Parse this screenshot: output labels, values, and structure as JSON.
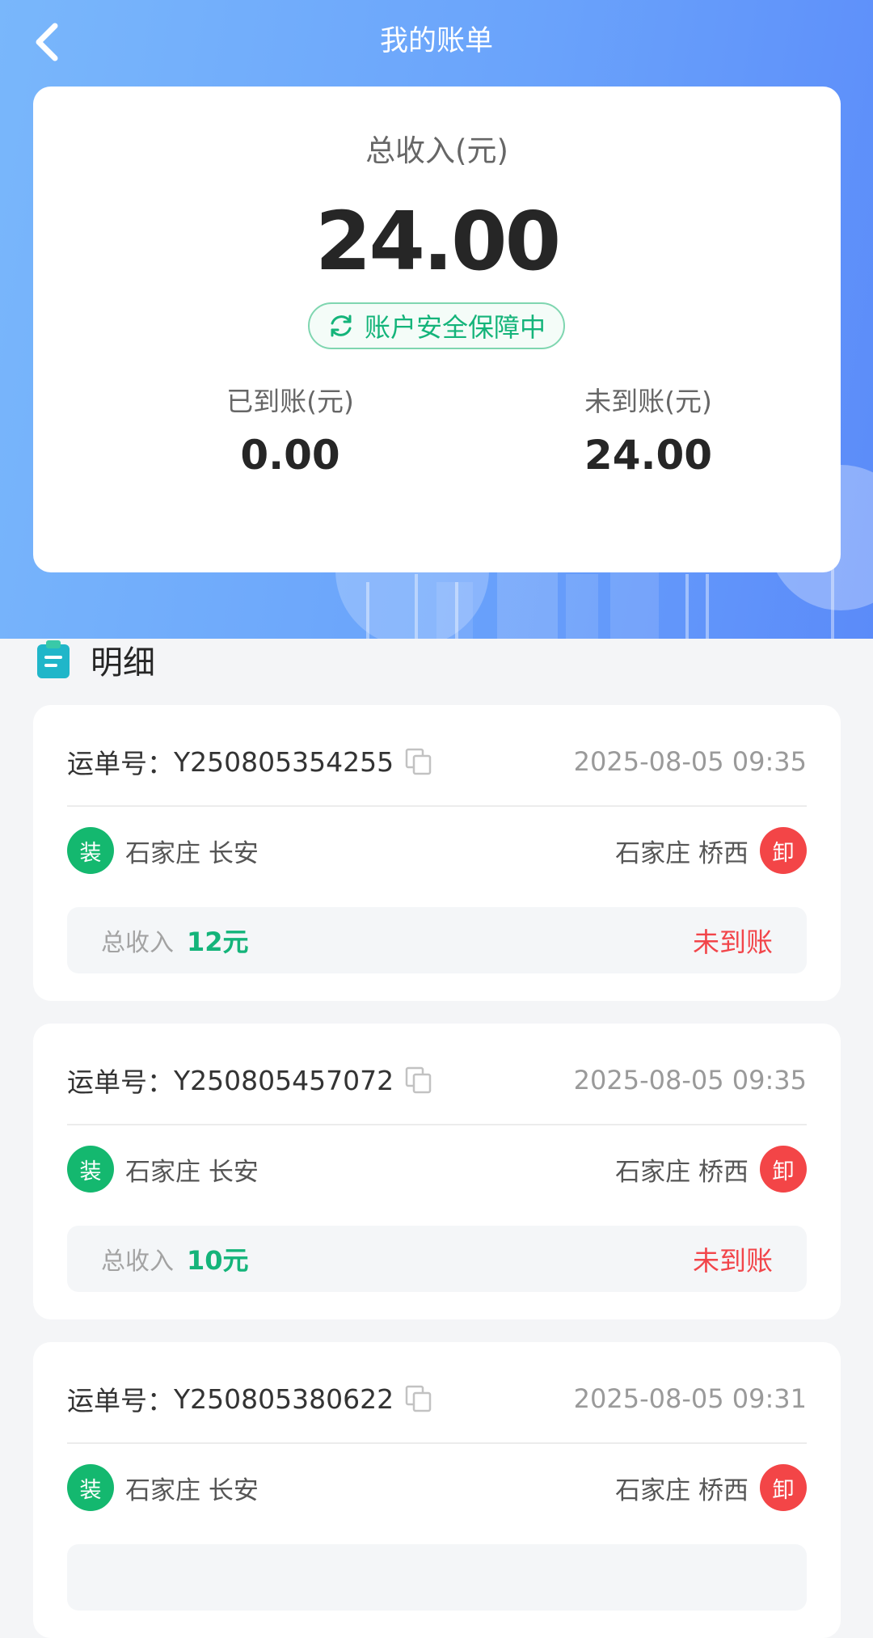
{
  "header": {
    "title": "我的账单",
    "back_icon": "chevron-left-icon"
  },
  "summary": {
    "total_label": "总收入(元)",
    "total_amount": "24.00",
    "security_text": "账户安全保障中",
    "received_label": "已到账(元)",
    "received_amount": "0.00",
    "pending_label": "未到账(元)",
    "pending_amount": "24.00"
  },
  "section": {
    "title": "明细",
    "icon": "clipboard-icon"
  },
  "records": [
    {
      "waybill_label": "运单号：",
      "waybill_no": "Y250805354255",
      "time": "2025-08-05 09:35",
      "load_tag": "装",
      "from": "石家庄 长安",
      "to": "石家庄 桥西",
      "unload_tag": "卸",
      "income_label": "总收入",
      "income_amount": "12元",
      "status": "未到账"
    },
    {
      "waybill_label": "运单号：",
      "waybill_no": "Y250805457072",
      "time": "2025-08-05 09:35",
      "load_tag": "装",
      "from": "石家庄 长安",
      "to": "石家庄 桥西",
      "unload_tag": "卸",
      "income_label": "总收入",
      "income_amount": "10元",
      "status": "未到账"
    },
    {
      "waybill_label": "运单号：",
      "waybill_no": "Y250805380622",
      "time": "2025-08-05 09:31",
      "load_tag": "装",
      "from": "石家庄 长安",
      "to": "石家庄 桥西",
      "unload_tag": "卸",
      "income_label": "",
      "income_amount": "",
      "status": ""
    }
  ],
  "colors": {
    "accent_green": "#14b47a",
    "alert_red": "#f2454a",
    "header_blue": "#6aa3fb"
  }
}
